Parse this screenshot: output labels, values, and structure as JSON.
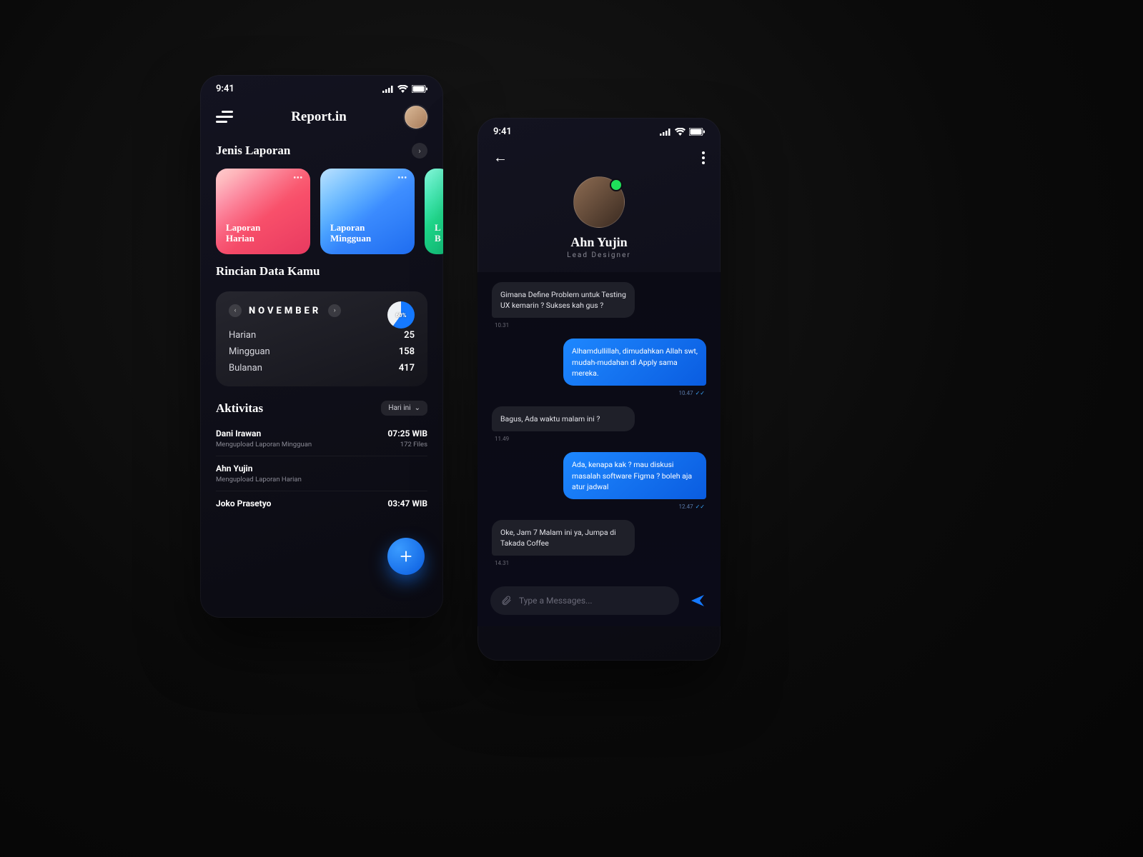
{
  "status": {
    "time": "9:41"
  },
  "device1": {
    "brand": "Report.in",
    "section1": "Jenis Laporan",
    "cards": [
      {
        "title": "Laporan\nHarian"
      },
      {
        "title": "Laporan\nMingguan"
      },
      {
        "title": "L\nB"
      }
    ],
    "section2": "Rincian Data Kamu",
    "month": "NOVEMBER",
    "pct": "60%",
    "rows": [
      {
        "k": "Harian",
        "v": "25"
      },
      {
        "k": "Mingguan",
        "v": "158"
      },
      {
        "k": "Bulanan",
        "v": "417"
      }
    ],
    "section3": "Aktivitas",
    "filter": "Hari ini",
    "activities": [
      {
        "name": "Dani Irawan",
        "time": "07:25 WIB",
        "sub": "Mengupload Laporan Mingguan",
        "meta": "172 Files"
      },
      {
        "name": "Ahn Yujin",
        "time": "",
        "sub": "Mengupload Laporan Harian",
        "meta": ""
      },
      {
        "name": "Joko Prasetyo",
        "time": "03:47 WIB",
        "sub": "",
        "meta": ""
      }
    ]
  },
  "device2": {
    "name": "Ahn Yujin",
    "role": "Lead Designer",
    "messages": [
      {
        "dir": "in",
        "text": "Gimana Define Problem untuk Testing UX kemarin ? Sukses kah gus ?",
        "ts": "10.31"
      },
      {
        "dir": "out",
        "text": "Alhamdullillah, dimudahkan Allah swt, mudah-mudahan di Apply sama mereka.",
        "ts": "10.47"
      },
      {
        "dir": "in",
        "text": "Bagus, Ada waktu malam ini ?",
        "ts": "11.49"
      },
      {
        "dir": "out",
        "text": "Ada, kenapa kak ? mau diskusi masalah software Figma ? boleh aja atur jadwal",
        "ts": "12.47"
      },
      {
        "dir": "in",
        "text": "Oke, Jam 7 Malam ini ya, Jumpa di Takada Coffee",
        "ts": "14.31"
      }
    ],
    "placeholder": "Type a Messages..."
  }
}
